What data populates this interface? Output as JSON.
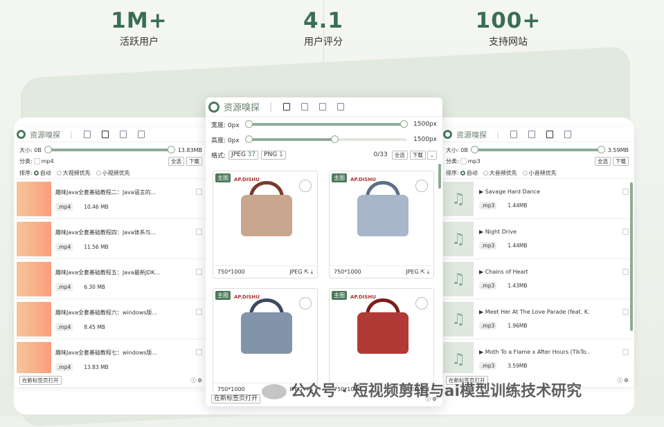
{
  "stats": [
    {
      "num": "1M+",
      "label": "活跃用户"
    },
    {
      "num": "4.1",
      "label": "用户评分"
    },
    {
      "num": "100+",
      "label": "支持网站"
    }
  ],
  "app_title": "资源嗅探",
  "left": {
    "size_label": "大小: 0B",
    "size_max": "13.83MB",
    "cat_label": "分类:",
    "cat_opt": "mp4",
    "select_all": "全选",
    "download": "下载",
    "sort_label": "排序:",
    "sort_opts": [
      "自动",
      "大视频优先",
      "小视频优先"
    ],
    "items": [
      {
        "title": "趣味Java全套基础教程二：Java语言的...",
        "type": ".mp4",
        "size": "10.46 MB"
      },
      {
        "title": "趣味Java全套基础教程四：Java体系与...",
        "type": ".mp4",
        "size": "11.56 MB"
      },
      {
        "title": "趣味Java全套基础教程五：Java最新JDK...",
        "type": ".mp4",
        "size": "6.30 MB"
      },
      {
        "title": "趣味Java全套基础教程六：windows版...",
        "type": ".mp4",
        "size": "8.45 MB"
      },
      {
        "title": "趣味Java全套基础教程七：windows版...",
        "type": ".mp4",
        "size": "13.83 MB"
      }
    ],
    "open_tab": "在新标签页打开"
  },
  "center": {
    "width_label": "宽度: 0px",
    "width_max": "1500px",
    "height_label": "高度: 0px",
    "height_max": "1500px",
    "format_label": "格式:",
    "formats": [
      {
        "name": "JPEG",
        "count": "37"
      },
      {
        "name": "PNG",
        "count": "1"
      }
    ],
    "count": "0/33",
    "select_all": "全选",
    "download": "下载",
    "cards": [
      {
        "badge": "主图",
        "brand": "AP.DISHU",
        "dims": "750*1000",
        "format": "JPEG",
        "color": "#c9a68e",
        "handle": "#7a3b2a"
      },
      {
        "badge": "主图",
        "brand": "AP.DISHU",
        "dims": "750*1000",
        "format": "JPEG",
        "color": "#a7b6c8",
        "handle": "#5e6f8a"
      },
      {
        "badge": "主图",
        "brand": "AP.DISHU",
        "dims": "750*1000",
        "format": "JPEG",
        "color": "#8294aa",
        "handle": "#3d4a60"
      },
      {
        "badge": "主图",
        "brand": "AP.DISHU",
        "dims": "750*1000",
        "format": "JPEG",
        "color": "#b23a36",
        "handle": "#7a1f1c"
      }
    ],
    "open_tab": "在新标签页打开"
  },
  "right": {
    "size_label": "大小: 0B",
    "size_max": "3.59MB",
    "cat_label": "分类:",
    "cat_opt": "mp3",
    "select_all": "全选",
    "download": "下载",
    "sort_label": "排序:",
    "sort_opts": [
      "自动",
      "大音频优先",
      "小音频优先"
    ],
    "items": [
      {
        "title": "▶ Savage Hard Dance",
        "type": ".mp3",
        "size": "1.44MB"
      },
      {
        "title": "▶ Night Drive",
        "type": ".mp3",
        "size": "1.44MB"
      },
      {
        "title": "▶ Chains of Heart",
        "type": ".mp3",
        "size": "1.43MB"
      },
      {
        "title": "▶ Meet Her At The Love Parade (feat. K...",
        "type": ".mp3",
        "size": "1.96MB"
      },
      {
        "title": "▶ Moth To a Flame x After Hours (TikTo...",
        "type": ".mp3",
        "size": "3.59MB"
      }
    ],
    "open_tab": "在新标签页打开"
  },
  "watermark": "公众号 · 短视频剪辑与ai模型训练技术研究"
}
